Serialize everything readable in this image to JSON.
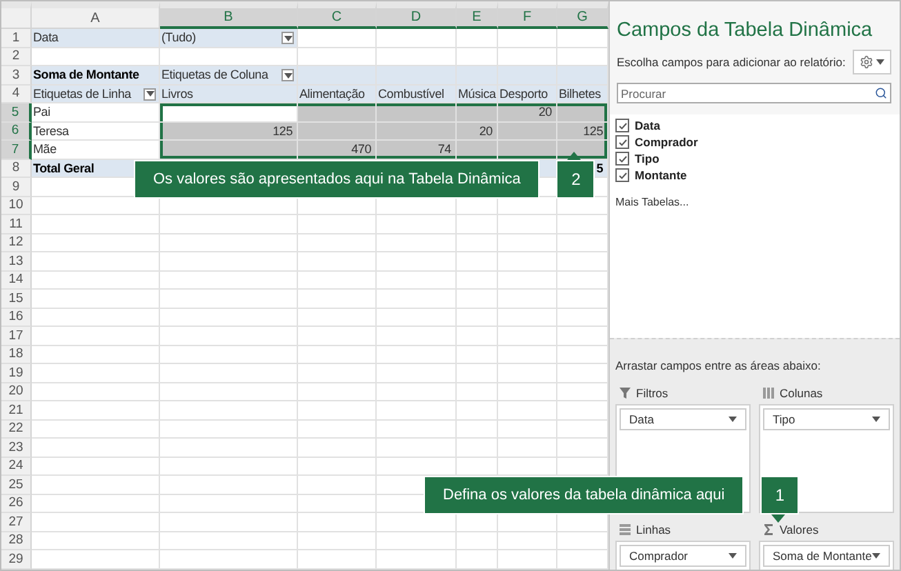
{
  "sheet": {
    "columns": [
      "A",
      "B",
      "C",
      "D",
      "E",
      "F",
      "G"
    ],
    "rows": [
      {
        "number": "1",
        "kind": "filter",
        "cells": [
          {
            "text": "Data",
            "dropdown": false
          },
          {
            "text": "(Tudo)",
            "dropdown": true
          }
        ]
      },
      {
        "number": "2",
        "kind": "empty"
      },
      {
        "number": "3",
        "kind": "header",
        "cells": [
          {
            "text": "Soma de Montante",
            "dropdown": false
          },
          {
            "text": "Etiquetas de Coluna",
            "dropdown": true
          },
          {
            "dropdown": false
          },
          {
            "dropdown": false
          },
          {
            "dropdown": false
          },
          {
            "dropdown": false
          },
          {
            "dropdown": false
          }
        ]
      },
      {
        "number": "4",
        "kind": "header",
        "cells": [
          {
            "text": "Etiquetas de Linha",
            "dropdown": true
          },
          {
            "text": "Livros",
            "dropdown": false
          },
          {
            "text": "Alimentação",
            "dropdown": false
          },
          {
            "text": "Combustível",
            "dropdown": false
          },
          {
            "text": "Música",
            "dropdown": false
          },
          {
            "text": "Desporto",
            "dropdown": false
          },
          {
            "text": "Bilhetes",
            "dropdown": false
          }
        ]
      },
      {
        "number": "5",
        "kind": "data",
        "cells": [
          {
            "text": "Pai",
            "selected": false
          },
          {
            "selected": true
          },
          {
            "selected": true
          },
          {
            "selected": true
          },
          {
            "selected": true
          },
          {
            "text": "20",
            "selected": true
          },
          {
            "selected": true
          }
        ]
      },
      {
        "number": "6",
        "kind": "data",
        "cells": [
          {
            "text": "Teresa",
            "selected": false
          },
          {
            "text": "125",
            "selected": true
          },
          {
            "selected": true
          },
          {
            "selected": true
          },
          {
            "text": "20",
            "selected": true
          },
          {
            "selected": true
          },
          {
            "text": "125",
            "selected": true
          }
        ]
      },
      {
        "number": "7",
        "kind": "data",
        "cells": [
          {
            "text": "Mãe",
            "selected": false
          },
          {
            "selected": true
          },
          {
            "text": "470",
            "selected": true
          },
          {
            "text": "74",
            "selected": true
          },
          {
            "selected": true
          },
          {
            "selected": true
          },
          {
            "selected": true
          }
        ]
      },
      {
        "number": "8",
        "kind": "total",
        "cells": [
          {
            "text": "Total Geral"
          },
          null,
          null,
          null,
          null,
          {},
          {
            "text": "5"
          }
        ]
      },
      {
        "number": "9",
        "kind": "empty"
      },
      {
        "number": "10",
        "kind": "empty"
      },
      {
        "number": "11",
        "kind": "empty"
      },
      {
        "number": "12",
        "kind": "empty"
      },
      {
        "number": "13",
        "kind": "empty"
      },
      {
        "number": "14",
        "kind": "empty"
      },
      {
        "number": "15",
        "kind": "empty"
      },
      {
        "number": "16",
        "kind": "empty"
      },
      {
        "number": "17",
        "kind": "empty"
      },
      {
        "number": "18",
        "kind": "empty"
      },
      {
        "number": "19",
        "kind": "empty"
      },
      {
        "number": "20",
        "kind": "empty"
      },
      {
        "number": "21",
        "kind": "empty"
      },
      {
        "number": "22",
        "kind": "empty"
      },
      {
        "number": "23",
        "kind": "empty"
      },
      {
        "number": "24",
        "kind": "empty"
      },
      {
        "number": "25",
        "kind": "empty"
      },
      {
        "number": "26",
        "kind": "empty"
      },
      {
        "number": "27",
        "kind": "empty"
      },
      {
        "number": "28",
        "kind": "empty"
      },
      {
        "number": "29",
        "kind": "empty"
      }
    ]
  },
  "pane": {
    "title": "Campos da Tabela Dinâmica",
    "subtitle": "Escolha campos para adicionar ao relatório:",
    "search": {
      "placeholder": "Procurar"
    },
    "fields": [
      {
        "label": "Data",
        "checked": true
      },
      {
        "label": "Comprador",
        "checked": true
      },
      {
        "label": "Tipo",
        "checked": true
      },
      {
        "label": "Montante",
        "checked": true
      }
    ],
    "more_tables": "Mais Tabelas...",
    "drag_hint": "Arrastar campos entre as áreas abaixo:",
    "areas": [
      {
        "kind": "filter",
        "label": "Filtros",
        "item": "Data"
      },
      {
        "kind": "columns",
        "label": "Colunas",
        "item": "Tipo"
      },
      {
        "kind": "rows",
        "label": "Linhas",
        "item": "Comprador"
      },
      {
        "kind": "values",
        "label": "Valores",
        "item": "Soma de Montante"
      }
    ]
  },
  "callouts": [
    {
      "text": "Os valores são apresentados aqui na Tabela Dinâmica",
      "number": "2"
    },
    {
      "text": "Defina os valores da tabela dinâmica aqui",
      "number": "1"
    }
  ]
}
